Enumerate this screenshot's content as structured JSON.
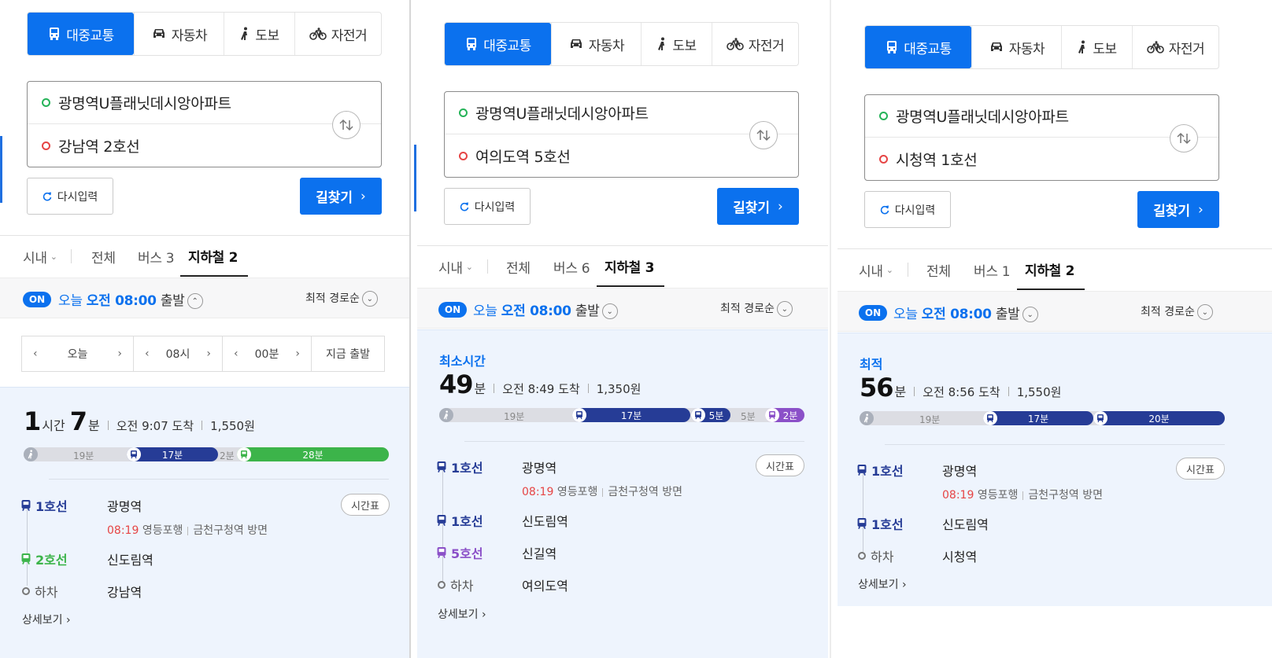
{
  "modes": {
    "transit": "대중교통",
    "car": "자동차",
    "walk": "도보",
    "bike": "자전거"
  },
  "common": {
    "reset": "다시입력",
    "search": "길찾기",
    "region": "시내",
    "tab_all": "전체",
    "on": "ON",
    "today": "오늘",
    "time_bold": "오전 08:00",
    "depart": "출발",
    "sort": "최적 경로순",
    "timetable": "시간표",
    "more": "상세보기 ›",
    "getoff": "하차",
    "arrive_suffix": "도착"
  },
  "picker": {
    "day": "오늘",
    "hour": "08시",
    "min": "00분",
    "now": "지금 출발"
  },
  "panels": [
    {
      "origin": "광명역U플래닛데시앙아파트",
      "destination": "강남역 2호선",
      "tab_bus": "버스 3",
      "tab_subway": "지하철 2",
      "result_label": "",
      "duration": {
        "h": "1",
        "h_unit": "시간",
        "m": "7",
        "m_unit": "분"
      },
      "arrive": "오전 9:07 도착",
      "fare": "1,550원",
      "timeline": {
        "walk": "19분",
        "seg1": "17분",
        "gap": "2분",
        "seg2": "28분"
      },
      "steps": [
        {
          "line": "1호선",
          "station": "광명역",
          "time": "08:19",
          "dir1": "영등포행",
          "dir2": "금천구청역 방면"
        },
        {
          "line": "2호선",
          "station": "신도림역"
        },
        {
          "station": "강남역"
        }
      ]
    },
    {
      "origin": "광명역U플래닛데시앙아파트",
      "destination": "여의도역 5호선",
      "tab_bus": "버스 6",
      "tab_subway": "지하철 3",
      "result_label": "최소시간",
      "duration": {
        "m": "49",
        "m_unit": "분"
      },
      "arrive": "오전 8:49 도착",
      "fare": "1,350원",
      "timeline": {
        "walk": "19분",
        "seg1": "17분",
        "seg2": "5분",
        "gap": "5분",
        "seg3": "2분"
      },
      "steps": [
        {
          "line": "1호선",
          "station": "광명역",
          "time": "08:19",
          "dir1": "영등포행",
          "dir2": "금천구청역 방면"
        },
        {
          "line": "1호선",
          "station": "신도림역"
        },
        {
          "line": "5호선",
          "station": "신길역"
        },
        {
          "station": "여의도역"
        }
      ]
    },
    {
      "origin": "광명역U플래닛데시앙아파트",
      "destination": "시청역 1호선",
      "tab_bus": "버스 1",
      "tab_subway": "지하철 2",
      "result_label": "최적",
      "duration": {
        "m": "56",
        "m_unit": "분"
      },
      "arrive": "오전 8:56 도착",
      "fare": "1,550원",
      "timeline": {
        "walk": "19분",
        "seg1": "17분",
        "seg2": "20분"
      },
      "steps": [
        {
          "line": "1호선",
          "station": "광명역",
          "time": "08:19",
          "dir1": "영등포행",
          "dir2": "금천구청역 방면"
        },
        {
          "line": "1호선",
          "station": "신도림역"
        },
        {
          "station": "시청역"
        }
      ]
    }
  ],
  "colors": {
    "accent": "#0b71ee",
    "line1": "#263c96",
    "line2": "#3cb44a",
    "line5": "#8b50c8",
    "red": "#e64545"
  }
}
